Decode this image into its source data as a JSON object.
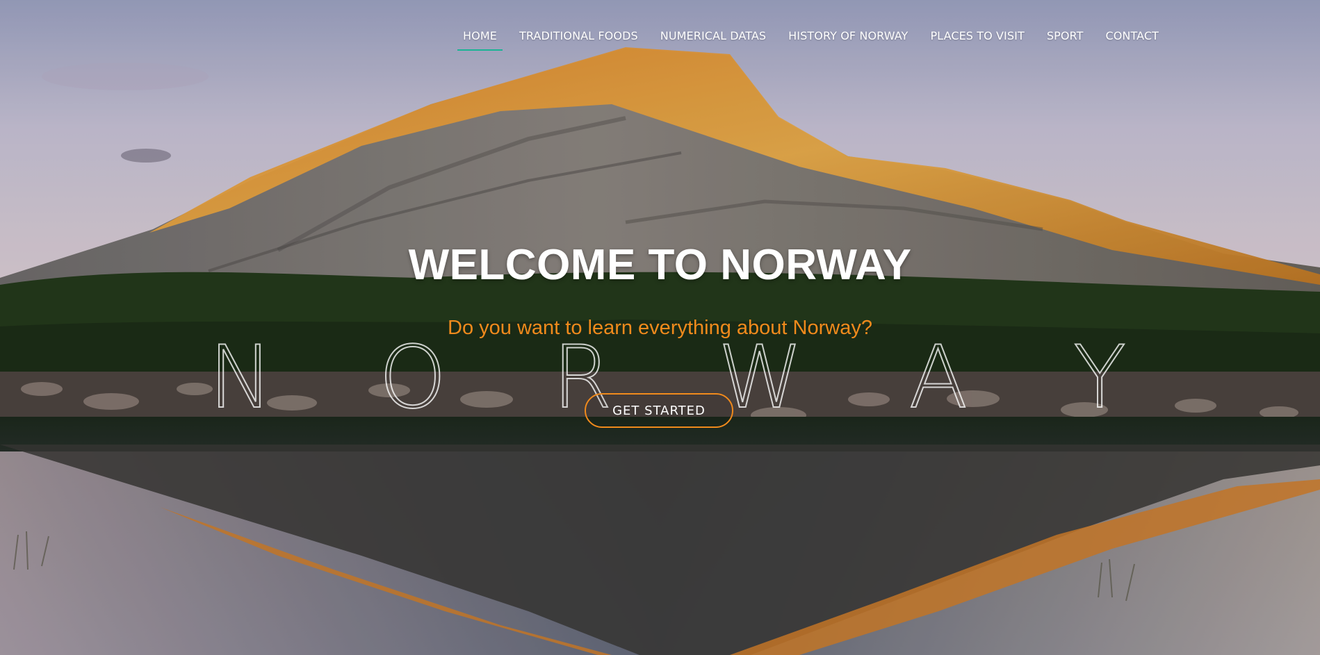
{
  "nav": {
    "items": [
      {
        "label": "HOME",
        "active": true
      },
      {
        "label": "TRADITIONAL FOODS",
        "active": false
      },
      {
        "label": "NUMERICAL DATAS",
        "active": false
      },
      {
        "label": "HISTORY OF NORWAY",
        "active": false
      },
      {
        "label": "PLACES TO VISIT",
        "active": false
      },
      {
        "label": "SPORT",
        "active": false
      },
      {
        "label": "CONTACT",
        "active": false
      }
    ]
  },
  "hero": {
    "title": "WELCOME TO NORWAY",
    "subtitle": "Do you want to learn everything about Norway?",
    "outline_letters": [
      "N",
      "O",
      "R",
      "W",
      "A",
      "Y"
    ],
    "cta_label": "GET STARTED"
  },
  "colors": {
    "accent_orange": "#f08a1c",
    "nav_active_underline": "#1bb394",
    "text_white": "#ffffff"
  }
}
